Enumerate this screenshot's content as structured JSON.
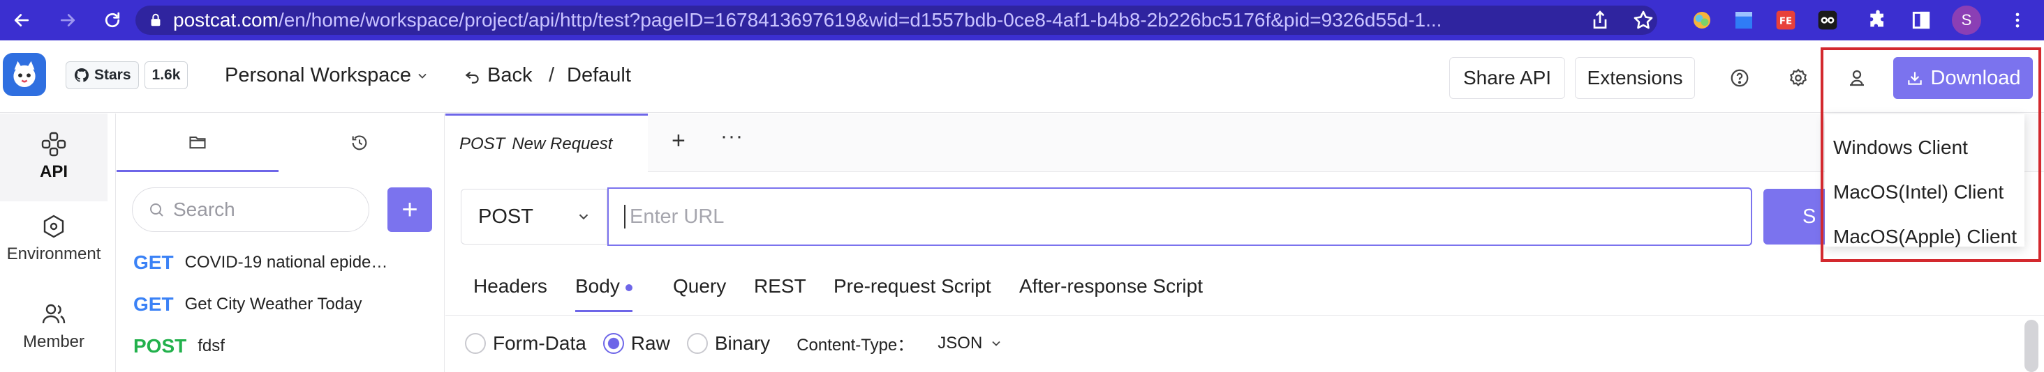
{
  "browser": {
    "url_host": "postcat.com",
    "url_path": "/en/home/workspace/project/api/http/test?pageID=1678413697619&wid=d1557bdb-0ce8-4af1-b4b8-2b226bc5176f&pid=9326d55d-1...",
    "profile_initial": "S",
    "theme_color": "#3b2fd0"
  },
  "header": {
    "stars_label": "Stars",
    "stars_count": "1.6k",
    "workspace": "Personal Workspace",
    "back_label": "Back",
    "breadcrumb_sep": "/",
    "breadcrumb_current": "Default",
    "share_label": "Share API",
    "extensions_label": "Extensions",
    "download_label": "Download"
  },
  "rail": [
    {
      "label": "API",
      "icon": "api-icon",
      "active": true
    },
    {
      "label": "Environment",
      "icon": "environment-icon",
      "active": false
    },
    {
      "label": "Member",
      "icon": "member-icon",
      "active": false
    }
  ],
  "panel": {
    "search_placeholder": "Search",
    "add_label": "+",
    "apis": [
      {
        "method": "GET",
        "name": "COVID-19 national epide…"
      },
      {
        "method": "GET",
        "name": "Get City Weather Today"
      },
      {
        "method": "POST",
        "name": "fdsf"
      }
    ]
  },
  "editor": {
    "tab_method": "POST",
    "tab_name": "New Request",
    "tab_add": "+",
    "tab_more": "···",
    "method": "POST",
    "url_placeholder": "Enter URL",
    "send_label": "S",
    "subtabs": [
      "Headers",
      "Body",
      "Query",
      "REST",
      "Pre-request Script",
      "After-response Script"
    ],
    "active_subtab": "Body",
    "body_types": [
      "Form-Data",
      "Raw",
      "Binary"
    ],
    "selected_body_type": "Raw",
    "content_type_label": "Content-Type：",
    "content_type_value": "JSON"
  },
  "download_menu": {
    "items": [
      "Windows Client",
      "MacOS(Intel) Client",
      "MacOS(Apple) Client"
    ],
    "highlight_color": "#d3292e"
  },
  "colors": {
    "accent": "#7b73ee",
    "get": "#3b82f6",
    "post": "#22b14c"
  }
}
